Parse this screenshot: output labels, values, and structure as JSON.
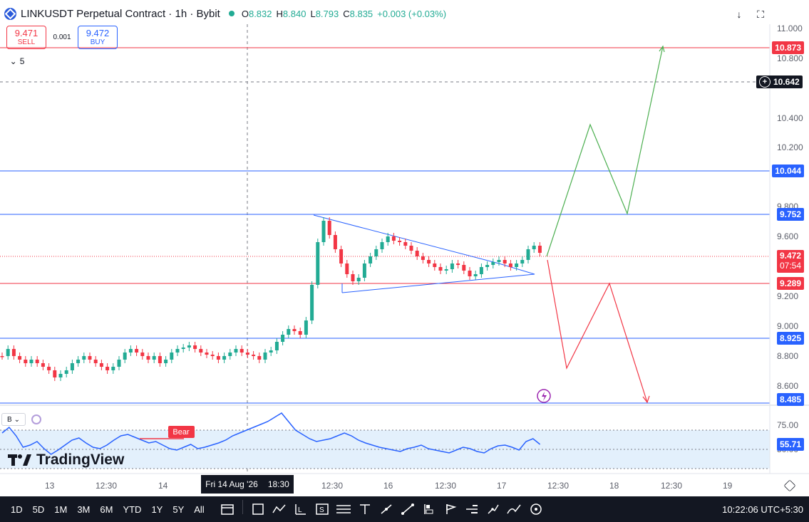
{
  "header": {
    "symbol_title": "LINKUSDT Perpetual Contract · 1h · Bybit",
    "ohlc": {
      "o_label": "O",
      "o": "8.832",
      "h_label": "H",
      "h": "8.840",
      "l_label": "L",
      "l": "8.793",
      "c_label": "C",
      "c": "8.835",
      "change": "+0.003 (+0.03%)"
    }
  },
  "trade": {
    "sell_price": "9.471",
    "sell_label": "SELL",
    "spread": "0.001",
    "buy_price": "9.472",
    "buy_label": "BUY"
  },
  "collapse_label": "5",
  "price_axis": {
    "ticks": [
      "11.000",
      "10.800",
      "10.400",
      "10.200",
      "9.800",
      "9.600",
      "9.200",
      "9.000",
      "8.800",
      "8.600",
      "75.00",
      "50.00"
    ],
    "labels": {
      "l10873": "10.873",
      "l10642": "10.642",
      "l10044": "10.044",
      "l9752": "9.752",
      "l9472": "9.472",
      "l_countdown": "07:54",
      "l9289": "9.289",
      "l8925": "8.925",
      "l8485": "8.485",
      "rsi_value": "55.71"
    }
  },
  "time_axis": {
    "labels": [
      "13",
      "12:30",
      "14",
      "12:30",
      "16",
      "12:30",
      "17",
      "12:30",
      "18",
      "12:30",
      "19"
    ],
    "crosshair_date": "Fri 14 Aug '26",
    "crosshair_time": "18:30"
  },
  "indicator": {
    "bear_label": "Bear",
    "collapse_btn": "B"
  },
  "branding": {
    "name": "TradingView"
  },
  "bottom_bar": {
    "timeframes": [
      "1D",
      "5D",
      "1M",
      "3M",
      "6M",
      "YTD",
      "1Y",
      "5Y",
      "All"
    ],
    "clock": "10:22:06 UTC+5:30"
  },
  "colors": {
    "up": "#22ab94",
    "down": "#f23645",
    "blue": "#2962ff",
    "red_line": "#f23645",
    "projection_up": "#4caf50",
    "projection_down": "#f23645"
  }
}
